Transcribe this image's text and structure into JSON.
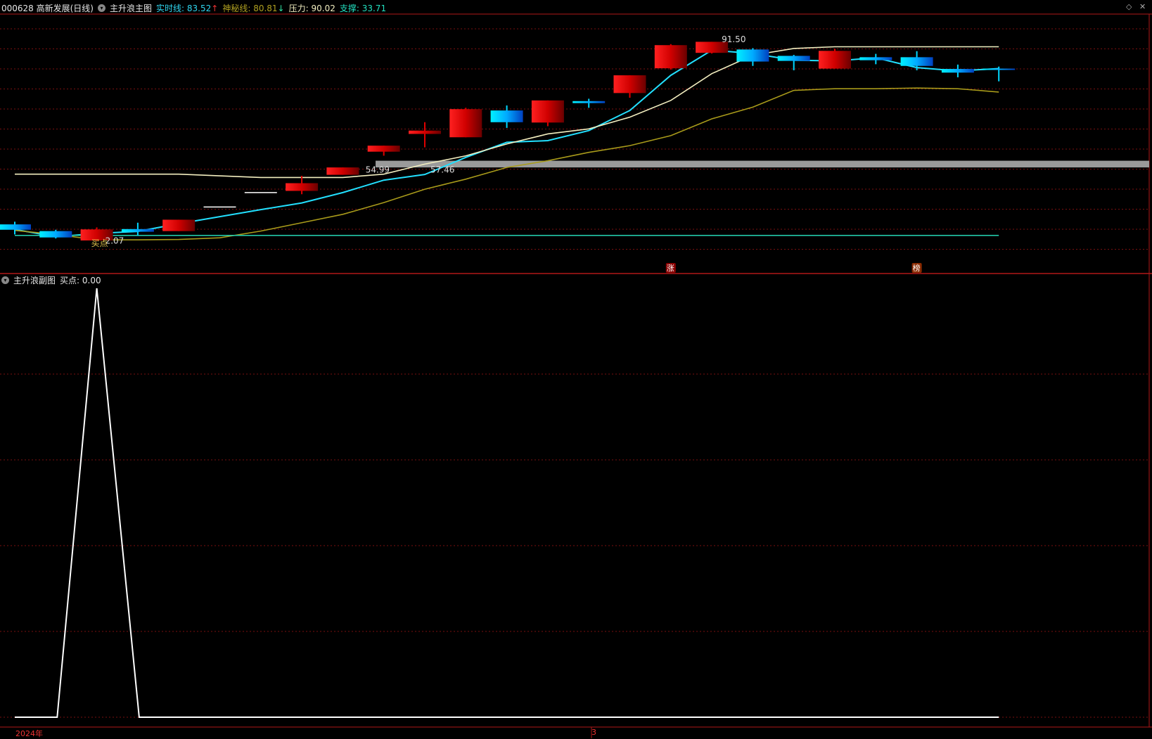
{
  "colors": {
    "bg": "#000000",
    "grid": "#7a1010",
    "frame": "#b01818",
    "rise": "#e00000",
    "fall": "#00d8ff",
    "realtime": "#22e0ff",
    "mystic": "#a89a1a",
    "pressure": "#f2eec0",
    "support": "#22c8a8",
    "band": "#9a9a9a",
    "sub_line": "#ffffff",
    "tag_zhang": "#8a0000",
    "tag_bang": "#8a2a00",
    "label_text": "#dddddd",
    "value_realtime": "#2fd6f0",
    "value_mystic": "#b0a020",
    "value_pressure": "#f2eec0",
    "value_support": "#22e0c0"
  },
  "main_header": {
    "stock": "000628 高新发展(日线)",
    "indicator": "主升浪主图",
    "realtime_label": "实时线:",
    "realtime_value": "83.52",
    "mystic_label": "神秘线:",
    "mystic_value": "80.81",
    "pressure_label": "压力:",
    "pressure_value": "90.02",
    "support_label": "支撑:",
    "support_value": "33.71"
  },
  "sub_header": {
    "indicator": "主升浪副图",
    "buy_label": "买点:",
    "buy_value": "0.00"
  },
  "x_axis": {
    "labels": [
      "2024年",
      "3"
    ]
  },
  "chart_data": [
    {
      "type": "candlestick",
      "title": "主升浪主图",
      "ylim": [
        28,
        96
      ],
      "candles": [
        {
          "o": 37.0,
          "c": 35.4,
          "h": 37.8,
          "l": 34.0
        },
        {
          "o": 35.0,
          "c": 33.1,
          "h": 35.4,
          "l": 32.8
        },
        {
          "o": 32.2,
          "c": 35.5,
          "h": 36.1,
          "l": 32.07
        },
        {
          "o": 35.6,
          "c": 34.8,
          "h": 37.5,
          "l": 33.6
        },
        {
          "o": 35.0,
          "c": 38.4,
          "h": 38.4,
          "l": 35.0
        },
        {
          "o": 42.2,
          "c": 42.2,
          "h": 42.2,
          "l": 42.2
        },
        {
          "o": 46.5,
          "c": 46.5,
          "h": 46.5,
          "l": 46.5
        },
        {
          "o": 47.0,
          "c": 49.3,
          "h": 51.5,
          "l": 46.0
        },
        {
          "o": 51.8,
          "c": 54.0,
          "h": 54.0,
          "l": 51.8
        },
        {
          "o": 58.7,
          "c": 60.5,
          "h": 60.5,
          "l": 57.5
        },
        {
          "o": 64.0,
          "c": 65.0,
          "h": 67.5,
          "l": 60.0
        },
        {
          "o": 63.0,
          "c": 71.4,
          "h": 71.8,
          "l": 63.0
        },
        {
          "o": 71.0,
          "c": 67.5,
          "h": 72.5,
          "l": 65.8
        },
        {
          "o": 67.4,
          "c": 74.0,
          "h": 74.0,
          "l": 66.3
        },
        {
          "o": 73.8,
          "c": 73.2,
          "h": 74.5,
          "l": 71.8
        },
        {
          "o": 76.2,
          "c": 81.5,
          "h": 81.5,
          "l": 74.8
        },
        {
          "o": 83.6,
          "c": 90.5,
          "h": 90.8,
          "l": 83.2
        },
        {
          "o": 88.2,
          "c": 91.5,
          "h": 91.5,
          "l": 88.0
        },
        {
          "o": 89.2,
          "c": 85.6,
          "h": 89.6,
          "l": 84.3
        },
        {
          "o": 87.3,
          "c": 85.8,
          "h": 87.6,
          "l": 83.0
        },
        {
          "o": 83.5,
          "c": 88.8,
          "h": 89.4,
          "l": 83.5
        },
        {
          "o": 86.9,
          "c": 86.0,
          "h": 87.9,
          "l": 84.8
        },
        {
          "o": 86.9,
          "c": 84.3,
          "h": 88.7,
          "l": 83.0
        },
        {
          "o": 83.4,
          "c": 82.3,
          "h": 84.7,
          "l": 80.9
        },
        {
          "o": 83.5,
          "c": 83.1,
          "h": 84.1,
          "l": 79.7
        }
      ],
      "series": [
        {
          "name": "实时线",
          "values": [
            35.5,
            33.3,
            34.3,
            34.9,
            37.2,
            39.3,
            41.4,
            43.4,
            46.5,
            50.2,
            51.9,
            57.0,
            61.5,
            62.0,
            65.0,
            71.0,
            81.5,
            89.0,
            88.0,
            86.0,
            85.8,
            86.7,
            83.8,
            82.8,
            83.52
          ]
        },
        {
          "name": "神秘线",
          "values": [
            35.2,
            34.0,
            32.4,
            32.4,
            32.5,
            33.0,
            35.0,
            37.5,
            40.0,
            43.5,
            47.5,
            50.5,
            54.0,
            56.0,
            58.5,
            60.5,
            63.5,
            68.5,
            72.0,
            77.0,
            77.5,
            77.5,
            77.7,
            77.5,
            76.5
          ]
        },
        {
          "name": "压力",
          "values": [
            52.0,
            52.0,
            52.0,
            52.0,
            52.0,
            51.5,
            51.0,
            51.0,
            51.0,
            52.0,
            54.99,
            57.46,
            61.0,
            64.0,
            65.5,
            69.0,
            74.0,
            82.0,
            87.5,
            89.5,
            90.02,
            90.02,
            90.02,
            90.02,
            90.02
          ]
        },
        {
          "name": "支撑",
          "values": [
            33.71,
            33.71,
            33.71,
            33.71,
            33.71,
            33.71,
            33.71,
            33.71,
            33.71,
            33.71,
            33.71,
            33.71,
            33.71,
            33.71,
            33.71,
            33.71,
            33.71,
            33.71,
            33.71,
            33.71,
            33.71,
            33.71,
            33.71,
            33.71,
            33.71
          ]
        }
      ],
      "band": [
        54.0,
        56.0
      ],
      "annotations": [
        {
          "text": "2.07",
          "index": 2,
          "value": 32.07
        },
        {
          "text": "买点",
          "index": 2,
          "value": 32.6
        },
        {
          "text": "54.99",
          "index": 9,
          "value": 53.3
        },
        {
          "text": "57.46",
          "index": 10,
          "value": 53.3
        },
        {
          "text": "91.50",
          "index": 17,
          "value": 92.2
        }
      ],
      "tags": [
        {
          "text": "涨",
          "index": 16
        },
        {
          "text": "榜",
          "index": 22
        }
      ]
    },
    {
      "type": "line",
      "title": "主升浪副图",
      "ylim": [
        0,
        100
      ],
      "x": [
        0,
        1,
        2,
        3,
        4
      ],
      "series": [
        {
          "name": "买点",
          "values": [
            0,
            0,
            100,
            0,
            0
          ]
        }
      ]
    }
  ]
}
